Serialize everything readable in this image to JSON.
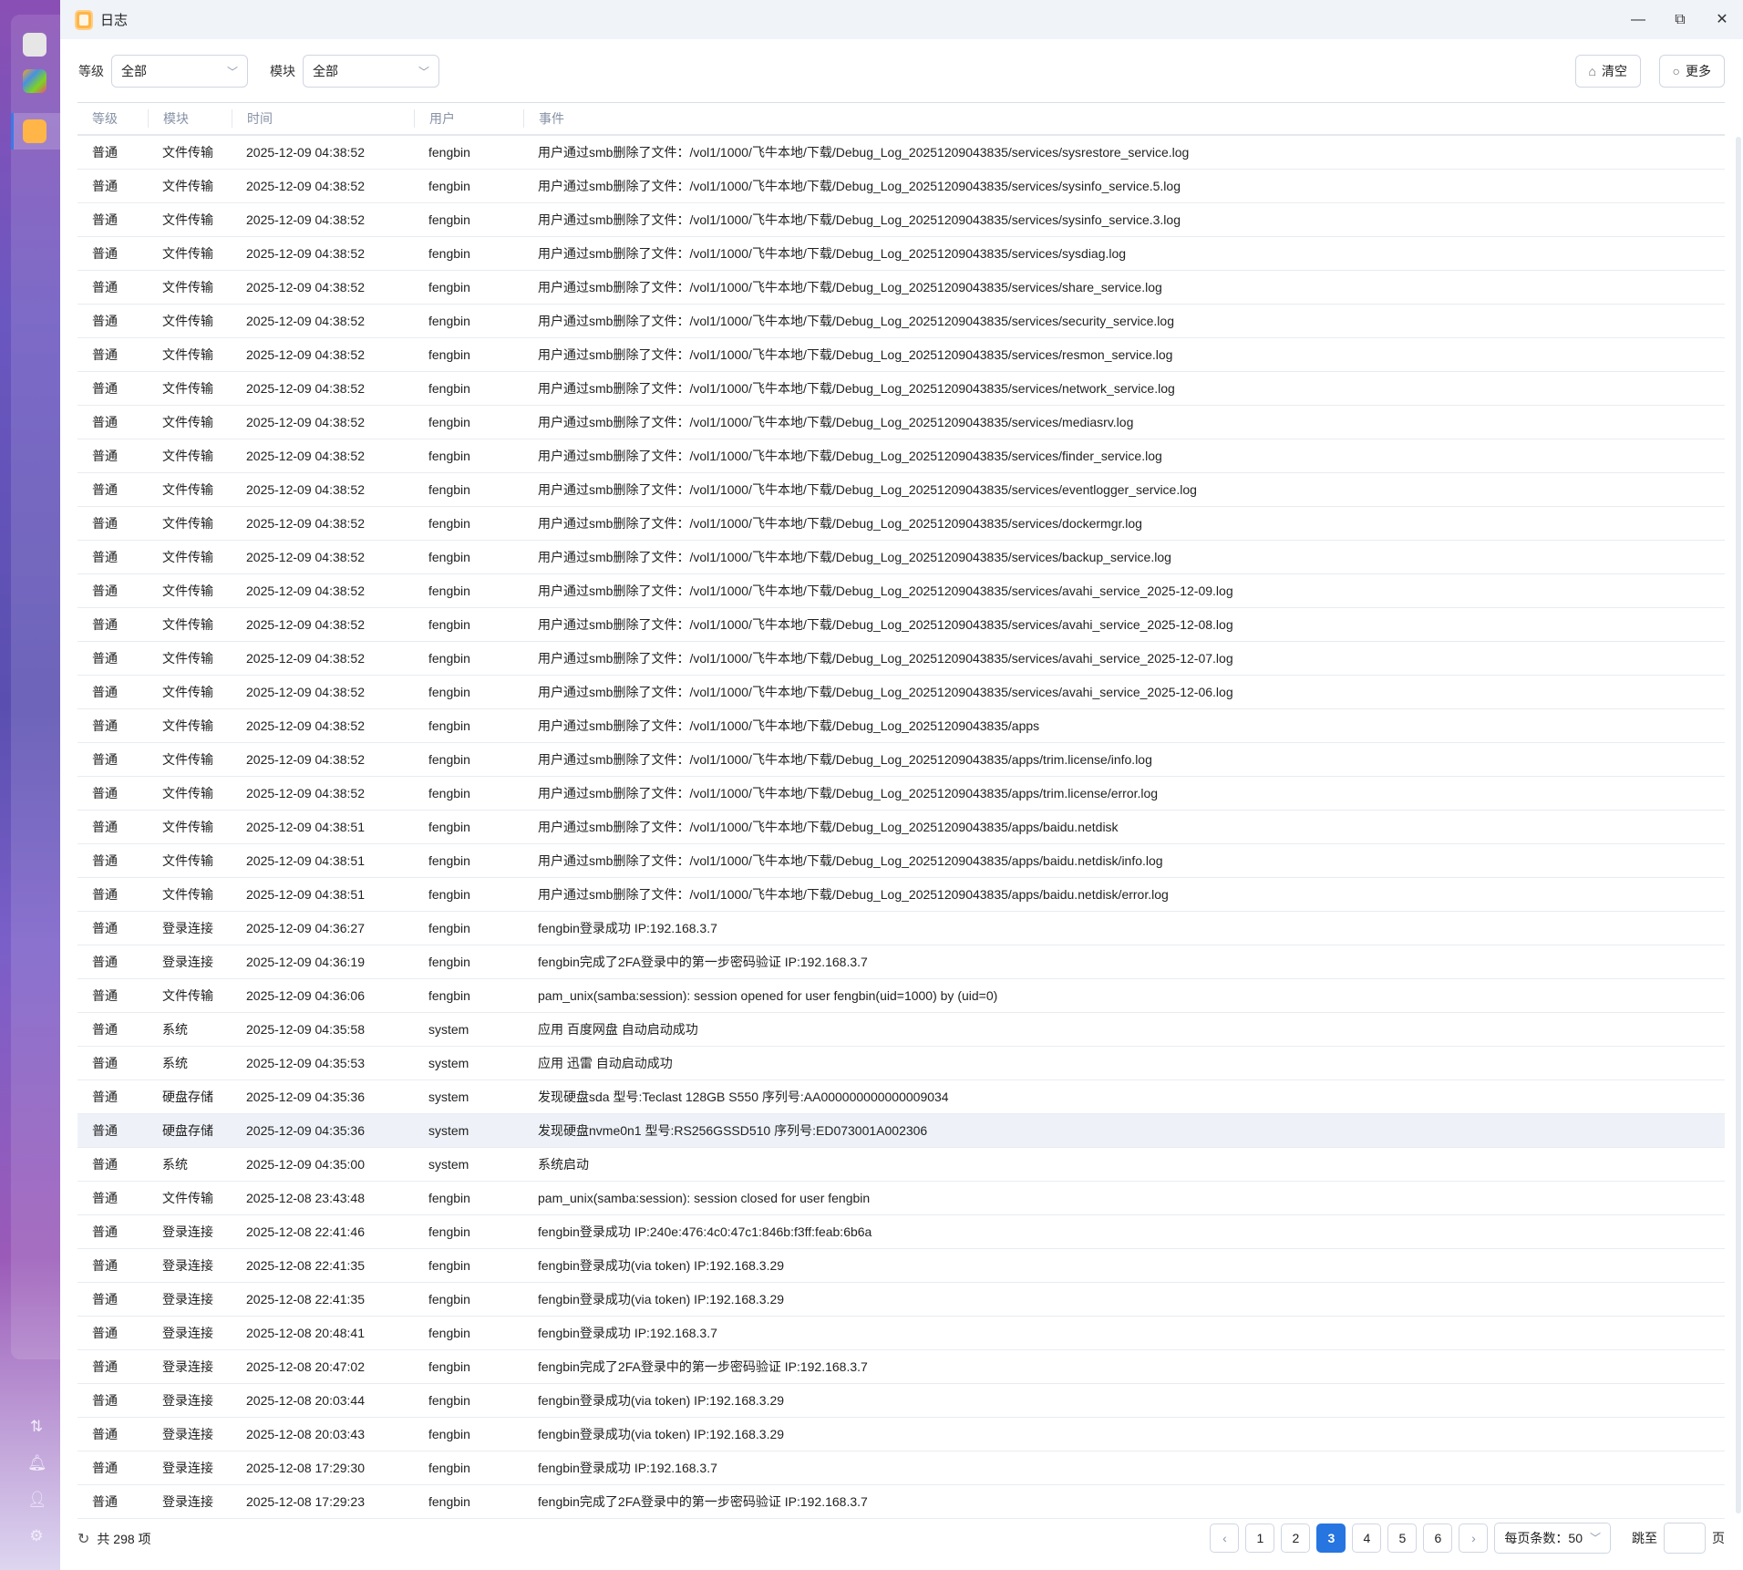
{
  "window": {
    "title": "日志",
    "minimize": "—",
    "maximize": "⧉",
    "close": "✕"
  },
  "filters": {
    "level_label": "等级",
    "level_value": "全部",
    "module_label": "模块",
    "module_value": "全部"
  },
  "toolbar": {
    "clear_label": "清空",
    "more_label": "更多"
  },
  "columns": [
    "等级",
    "模块",
    "时间",
    "用户",
    "事件"
  ],
  "rows": [
    [
      "普通",
      "文件传输",
      "2025-12-09 04:38:52",
      "fengbin",
      "用户通过smb删除了文件：/vol1/1000/飞牛本地/下载/Debug_Log_20251209043835/services/sysrestore_service.log"
    ],
    [
      "普通",
      "文件传输",
      "2025-12-09 04:38:52",
      "fengbin",
      "用户通过smb删除了文件：/vol1/1000/飞牛本地/下载/Debug_Log_20251209043835/services/sysinfo_service.5.log"
    ],
    [
      "普通",
      "文件传输",
      "2025-12-09 04:38:52",
      "fengbin",
      "用户通过smb删除了文件：/vol1/1000/飞牛本地/下载/Debug_Log_20251209043835/services/sysinfo_service.3.log"
    ],
    [
      "普通",
      "文件传输",
      "2025-12-09 04:38:52",
      "fengbin",
      "用户通过smb删除了文件：/vol1/1000/飞牛本地/下载/Debug_Log_20251209043835/services/sysdiag.log"
    ],
    [
      "普通",
      "文件传输",
      "2025-12-09 04:38:52",
      "fengbin",
      "用户通过smb删除了文件：/vol1/1000/飞牛本地/下载/Debug_Log_20251209043835/services/share_service.log"
    ],
    [
      "普通",
      "文件传输",
      "2025-12-09 04:38:52",
      "fengbin",
      "用户通过smb删除了文件：/vol1/1000/飞牛本地/下载/Debug_Log_20251209043835/services/security_service.log"
    ],
    [
      "普通",
      "文件传输",
      "2025-12-09 04:38:52",
      "fengbin",
      "用户通过smb删除了文件：/vol1/1000/飞牛本地/下载/Debug_Log_20251209043835/services/resmon_service.log"
    ],
    [
      "普通",
      "文件传输",
      "2025-12-09 04:38:52",
      "fengbin",
      "用户通过smb删除了文件：/vol1/1000/飞牛本地/下载/Debug_Log_20251209043835/services/network_service.log"
    ],
    [
      "普通",
      "文件传输",
      "2025-12-09 04:38:52",
      "fengbin",
      "用户通过smb删除了文件：/vol1/1000/飞牛本地/下载/Debug_Log_20251209043835/services/mediasrv.log"
    ],
    [
      "普通",
      "文件传输",
      "2025-12-09 04:38:52",
      "fengbin",
      "用户通过smb删除了文件：/vol1/1000/飞牛本地/下载/Debug_Log_20251209043835/services/finder_service.log"
    ],
    [
      "普通",
      "文件传输",
      "2025-12-09 04:38:52",
      "fengbin",
      "用户通过smb删除了文件：/vol1/1000/飞牛本地/下载/Debug_Log_20251209043835/services/eventlogger_service.log"
    ],
    [
      "普通",
      "文件传输",
      "2025-12-09 04:38:52",
      "fengbin",
      "用户通过smb删除了文件：/vol1/1000/飞牛本地/下载/Debug_Log_20251209043835/services/dockermgr.log"
    ],
    [
      "普通",
      "文件传输",
      "2025-12-09 04:38:52",
      "fengbin",
      "用户通过smb删除了文件：/vol1/1000/飞牛本地/下载/Debug_Log_20251209043835/services/backup_service.log"
    ],
    [
      "普通",
      "文件传输",
      "2025-12-09 04:38:52",
      "fengbin",
      "用户通过smb删除了文件：/vol1/1000/飞牛本地/下载/Debug_Log_20251209043835/services/avahi_service_2025-12-09.log"
    ],
    [
      "普通",
      "文件传输",
      "2025-12-09 04:38:52",
      "fengbin",
      "用户通过smb删除了文件：/vol1/1000/飞牛本地/下载/Debug_Log_20251209043835/services/avahi_service_2025-12-08.log"
    ],
    [
      "普通",
      "文件传输",
      "2025-12-09 04:38:52",
      "fengbin",
      "用户通过smb删除了文件：/vol1/1000/飞牛本地/下载/Debug_Log_20251209043835/services/avahi_service_2025-12-07.log"
    ],
    [
      "普通",
      "文件传输",
      "2025-12-09 04:38:52",
      "fengbin",
      "用户通过smb删除了文件：/vol1/1000/飞牛本地/下载/Debug_Log_20251209043835/services/avahi_service_2025-12-06.log"
    ],
    [
      "普通",
      "文件传输",
      "2025-12-09 04:38:52",
      "fengbin",
      "用户通过smb删除了文件：/vol1/1000/飞牛本地/下载/Debug_Log_20251209043835/apps"
    ],
    [
      "普通",
      "文件传输",
      "2025-12-09 04:38:52",
      "fengbin",
      "用户通过smb删除了文件：/vol1/1000/飞牛本地/下载/Debug_Log_20251209043835/apps/trim.license/info.log"
    ],
    [
      "普通",
      "文件传输",
      "2025-12-09 04:38:52",
      "fengbin",
      "用户通过smb删除了文件：/vol1/1000/飞牛本地/下载/Debug_Log_20251209043835/apps/trim.license/error.log"
    ],
    [
      "普通",
      "文件传输",
      "2025-12-09 04:38:51",
      "fengbin",
      "用户通过smb删除了文件：/vol1/1000/飞牛本地/下载/Debug_Log_20251209043835/apps/baidu.netdisk"
    ],
    [
      "普通",
      "文件传输",
      "2025-12-09 04:38:51",
      "fengbin",
      "用户通过smb删除了文件：/vol1/1000/飞牛本地/下载/Debug_Log_20251209043835/apps/baidu.netdisk/info.log"
    ],
    [
      "普通",
      "文件传输",
      "2025-12-09 04:38:51",
      "fengbin",
      "用户通过smb删除了文件：/vol1/1000/飞牛本地/下载/Debug_Log_20251209043835/apps/baidu.netdisk/error.log"
    ],
    [
      "普通",
      "登录连接",
      "2025-12-09 04:36:27",
      "fengbin",
      "fengbin登录成功 IP:192.168.3.7"
    ],
    [
      "普通",
      "登录连接",
      "2025-12-09 04:36:19",
      "fengbin",
      "fengbin完成了2FA登录中的第一步密码验证 IP:192.168.3.7"
    ],
    [
      "普通",
      "文件传输",
      "2025-12-09 04:36:06",
      "fengbin",
      "pam_unix(samba:session): session opened for user fengbin(uid=1000) by (uid=0)"
    ],
    [
      "普通",
      "系统",
      "2025-12-09 04:35:58",
      "system",
      "应用 百度网盘 自动启动成功"
    ],
    [
      "普通",
      "系统",
      "2025-12-09 04:35:53",
      "system",
      "应用 迅雷 自动启动成功"
    ],
    [
      "普通",
      "硬盘存储",
      "2025-12-09 04:35:36",
      "system",
      "发现硬盘sda 型号:Teclast 128GB S550 序列号:AA000000000000009034"
    ],
    [
      "普通",
      "硬盘存储",
      "2025-12-09 04:35:36",
      "system",
      "发现硬盘nvme0n1 型号:RS256GSSD510 序列号:ED073001A002306"
    ],
    [
      "普通",
      "系统",
      "2025-12-09 04:35:00",
      "system",
      "系统启动"
    ],
    [
      "普通",
      "文件传输",
      "2025-12-08 23:43:48",
      "fengbin",
      "pam_unix(samba:session): session closed for user fengbin"
    ],
    [
      "普通",
      "登录连接",
      "2025-12-08 22:41:46",
      "fengbin",
      "fengbin登录成功 IP:240e:476:4c0:47c1:846b:f3ff:feab:6b6a"
    ],
    [
      "普通",
      "登录连接",
      "2025-12-08 22:41:35",
      "fengbin",
      "fengbin登录成功(via token) IP:192.168.3.29"
    ],
    [
      "普通",
      "登录连接",
      "2025-12-08 22:41:35",
      "fengbin",
      "fengbin登录成功(via token) IP:192.168.3.29"
    ],
    [
      "普通",
      "登录连接",
      "2025-12-08 20:48:41",
      "fengbin",
      "fengbin登录成功 IP:192.168.3.7"
    ],
    [
      "普通",
      "登录连接",
      "2025-12-08 20:47:02",
      "fengbin",
      "fengbin完成了2FA登录中的第一步密码验证 IP:192.168.3.7"
    ],
    [
      "普通",
      "登录连接",
      "2025-12-08 20:03:44",
      "fengbin",
      "fengbin登录成功(via token) IP:192.168.3.29"
    ],
    [
      "普通",
      "登录连接",
      "2025-12-08 20:03:43",
      "fengbin",
      "fengbin登录成功(via token) IP:192.168.3.29"
    ],
    [
      "普通",
      "登录连接",
      "2025-12-08 17:29:30",
      "fengbin",
      "fengbin登录成功 IP:192.168.3.7"
    ],
    [
      "普通",
      "登录连接",
      "2025-12-08 17:29:23",
      "fengbin",
      "fengbin完成了2FA登录中的第一步密码验证 IP:192.168.3.7"
    ]
  ],
  "highlighted_row": 29,
  "footer": {
    "total": "共 298 项",
    "pages": [
      "1",
      "2",
      "3",
      "4",
      "5",
      "6"
    ],
    "current_page": "3",
    "per_page": "每页条数：50",
    "jump_label": "跳至",
    "page_suffix": "页"
  },
  "colors": {
    "accent": "#2675e0"
  }
}
